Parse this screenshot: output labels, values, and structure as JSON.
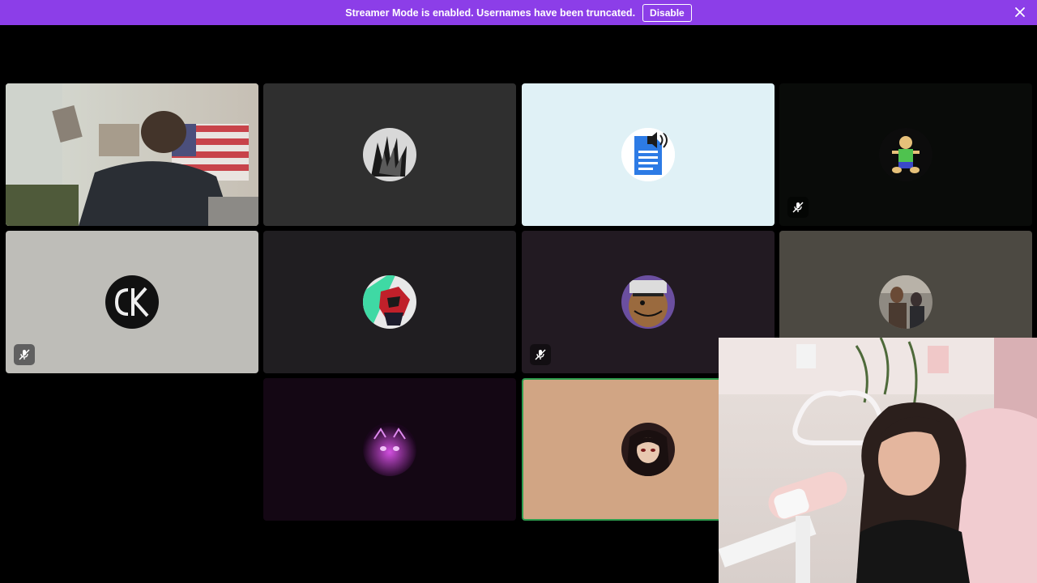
{
  "banner": {
    "message": "Streamer Mode is enabled. Usernames have been truncated.",
    "disable_label": "Disable",
    "close_icon": "close-icon",
    "color": "#8c3ee8"
  },
  "tiles": [
    {
      "kind": "video",
      "muted": false,
      "bg": "#b8b2a8"
    },
    {
      "kind": "avatar",
      "muted": false,
      "bg": "#2f2f2f"
    },
    {
      "kind": "avatar",
      "muted": false,
      "bg": "#e0f1f6",
      "icon": "document-speaker-icon"
    },
    {
      "kind": "avatar",
      "muted": true,
      "bg": "#090b09"
    },
    {
      "kind": "avatar",
      "muted": true,
      "bg": "#bebdb8"
    },
    {
      "kind": "avatar",
      "muted": false,
      "bg": "#201e21"
    },
    {
      "kind": "avatar",
      "muted": true,
      "bg": "#221a22"
    },
    {
      "kind": "avatar",
      "muted": false,
      "bg": "#4c4942"
    },
    {
      "kind": "avatar",
      "muted": false,
      "bg": "#140714"
    },
    {
      "kind": "avatar",
      "muted": false,
      "bg": "#d1a584",
      "speaking": true,
      "speaking_color": "#2e9e4f"
    }
  ],
  "pip": {
    "kind": "webcam-video"
  }
}
